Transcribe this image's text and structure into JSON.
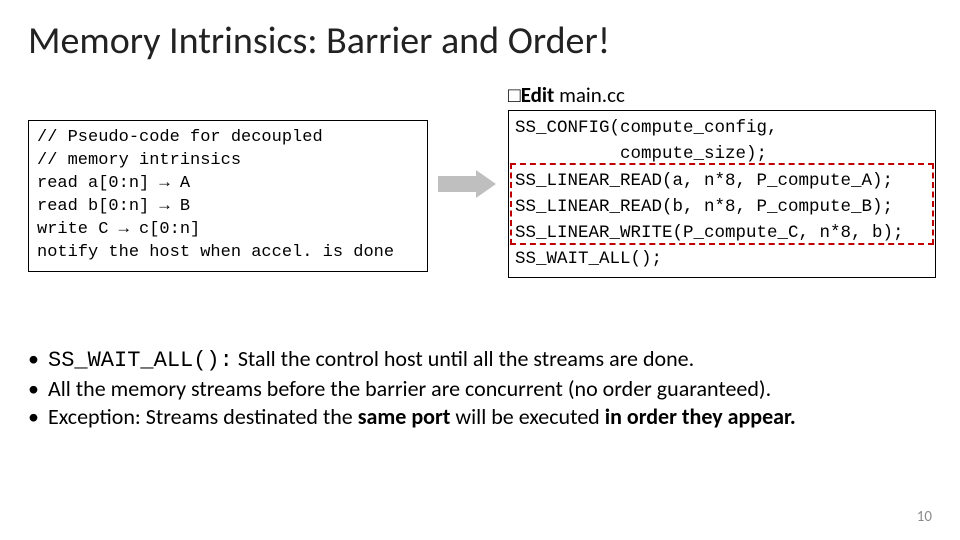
{
  "title": "Memory Intrinsics: Barrier and Order!",
  "left": {
    "l1": "// Pseudo-code for decoupled",
    "l2": "// memory intrinsics",
    "l3": "read a[0:n] → A",
    "l4": "read b[0:n] → B",
    "l5": "write C → c[0:n]",
    "l6": "notify the host when accel. is done"
  },
  "right_header": {
    "bullet": "□",
    "bold": "Edit",
    "rest": " main.cc"
  },
  "right": {
    "l1": "SS_CONFIG(compute_config,",
    "l2": "          compute_size);",
    "l3": "SS_LINEAR_READ(a, n*8, P_compute_A);",
    "l4": "SS_LINEAR_READ(b, n*8, P_compute_B);",
    "l5": "SS_LINEAR_WRITE(P_compute_C, n*8, b);",
    "l6": "SS_WAIT_ALL();"
  },
  "bullets": {
    "b1_mono": "SS_WAIT_ALL():",
    "b1_rest": "  Stall the control host until all the streams are done.",
    "b2": "All the memory streams before the barrier are concurrent (no order guaranteed).",
    "b3_a": "Exception: Streams destinated the ",
    "b3_b": "same port",
    "b3_c": " will be executed ",
    "b3_d": "in order they appear.",
    "dot": "•"
  },
  "slide_num": "10"
}
